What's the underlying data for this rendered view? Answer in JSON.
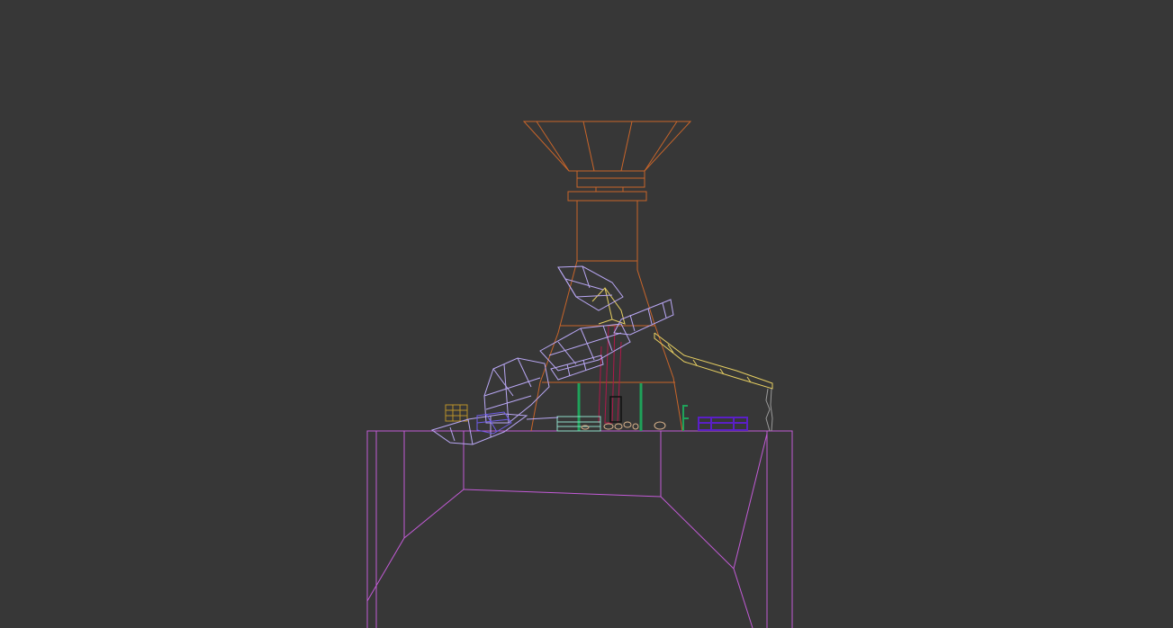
{
  "viewport": {
    "mode": "wireframe",
    "background": "#373737"
  },
  "colors": {
    "tower": "#c8652a",
    "base": "#c25bd6",
    "hand": "#b9a7f4",
    "hand_shadow": "#6f5ce8",
    "crane": "#e7cf62",
    "pillars": "#b0184a",
    "posts": "#1fa25a",
    "bench": "#5a1fc6",
    "crate": "#b9902a",
    "rocks": "#d9b38c",
    "chain": "#9a9a9a",
    "rail": "#8fdcc9",
    "door": "#111111"
  },
  "objects": [
    {
      "name": "tower-funnel-mesh"
    },
    {
      "name": "tower-column-mesh"
    },
    {
      "name": "base-block-mesh"
    },
    {
      "name": "giant-hand-mesh"
    },
    {
      "name": "crane-arm-mesh"
    },
    {
      "name": "red-pillars-mesh"
    },
    {
      "name": "green-posts-mesh"
    },
    {
      "name": "bench-mesh"
    },
    {
      "name": "crate-mesh"
    },
    {
      "name": "rocks-mesh"
    },
    {
      "name": "hanging-chain-mesh"
    }
  ]
}
